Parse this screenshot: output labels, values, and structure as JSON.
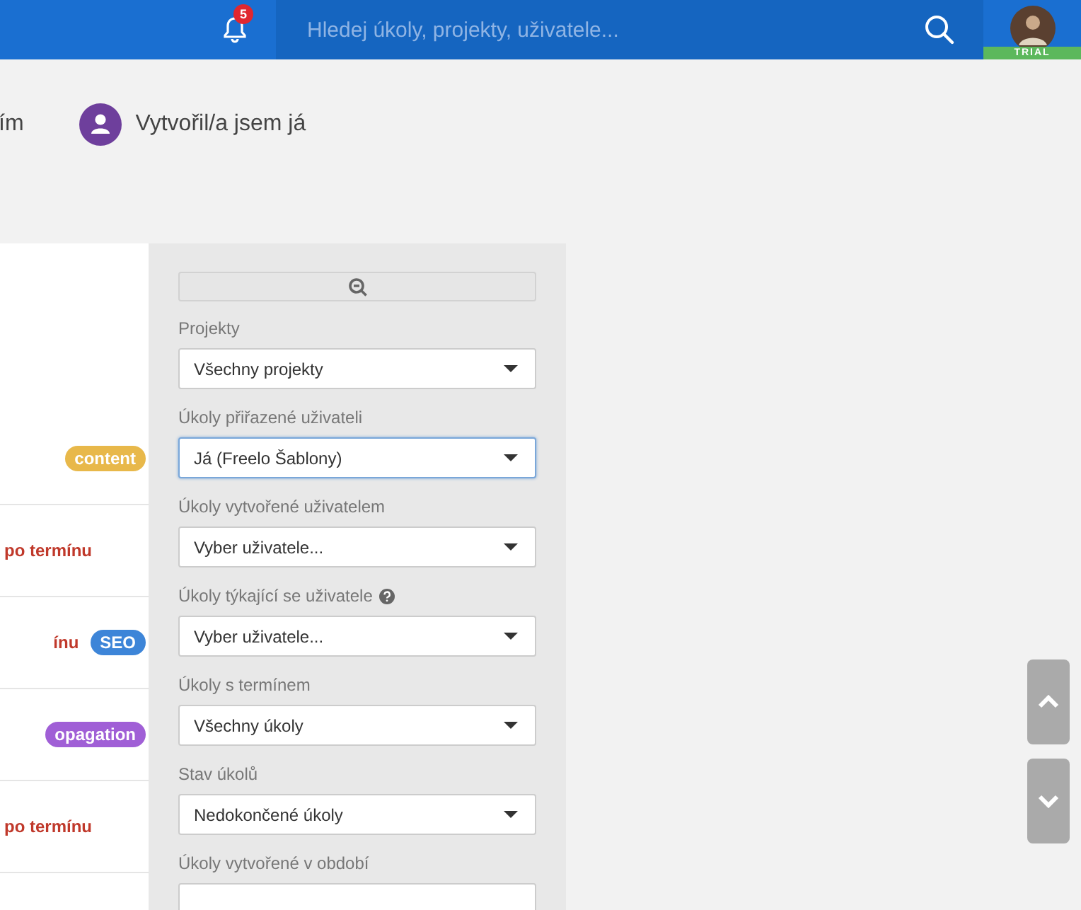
{
  "header": {
    "notification_count": "5",
    "search": {
      "placeholder": "Hledej úkoly, projekty, uživatele..."
    },
    "avatar_badge": "TRIAL"
  },
  "filter_tabs": [
    {
      "label": "ím",
      "kind": "text"
    },
    {
      "label": "Vytvořil/a jsem já",
      "kind": "avatar"
    }
  ],
  "tasks": [
    {
      "tag": {
        "label": "content",
        "color": "#e8b84a"
      }
    },
    {
      "status": "po termínu"
    },
    {
      "status": "ínu",
      "tag": {
        "label": "SEO",
        "color": "#3d85d8"
      }
    },
    {
      "tag": {
        "label": "opagation",
        "color": "#a05fd6"
      }
    },
    {
      "status": "po termínu"
    }
  ],
  "filters": [
    {
      "label": "Projekty",
      "value": "Všechny projekty",
      "focused": false,
      "help": false
    },
    {
      "label": "Úkoly přiřazené uživateli",
      "value": "Já (Freelo Šablony)",
      "focused": true,
      "help": false
    },
    {
      "label": "Úkoly vytvořené uživatelem",
      "value": "Vyber uživatele...",
      "focused": false,
      "help": false
    },
    {
      "label": "Úkoly týkající se uživatele",
      "value": "Vyber uživatele...",
      "focused": false,
      "help": true
    },
    {
      "label": "Úkoly s termínem",
      "value": "Všechny úkoly",
      "focused": false,
      "help": false
    },
    {
      "label": "Stav úkolů",
      "value": "Nedokončené úkoly",
      "focused": false,
      "help": false
    },
    {
      "label": "Úkoly vytvořené v období",
      "focused": false,
      "help": false
    }
  ]
}
